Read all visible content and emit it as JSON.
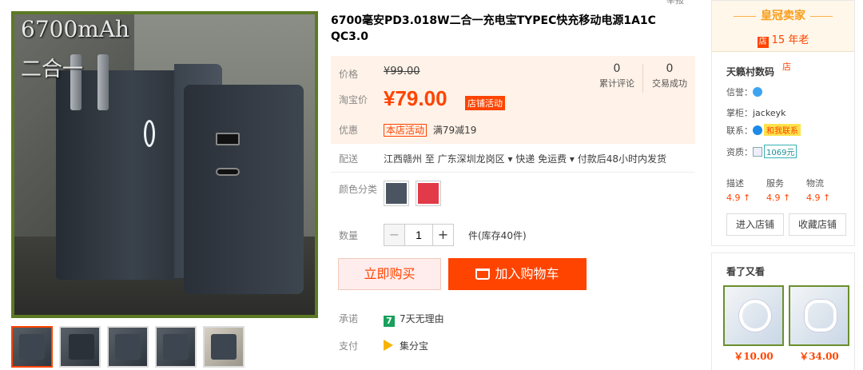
{
  "gallery": {
    "overlay_line1": "6700mAh",
    "overlay_line2": "二合一",
    "thumb_count": 5
  },
  "product": {
    "title": "6700毫安PD3.018W二合一充电宝TYPEC快充移动电源1A1C QC3.0",
    "topright": "举报"
  },
  "price": {
    "label": "价格",
    "original": "¥99.00",
    "tb_label": "淘宝价",
    "current": "¥79.00",
    "promo_tag": "店铺活动"
  },
  "stats": [
    {
      "num": "0",
      "label": "累计评论"
    },
    {
      "num": "0",
      "label": "交易成功"
    }
  ],
  "promotion": {
    "label": "优惠",
    "tag": "本店活动",
    "text": "满79减19"
  },
  "delivery": {
    "label": "配送",
    "text": "江西赣州 至  广东深圳龙岗区 ▾   快递 免运费 ▾   付款后48小时内发货"
  },
  "color": {
    "label": "颜色分类",
    "swatches": [
      "#4a5561",
      "#e23a48"
    ]
  },
  "quantity": {
    "label": "数量",
    "value": "1",
    "minus": "−",
    "plus": "+",
    "stock": "件(库存40件)"
  },
  "actions": {
    "buy_now": "立即购买",
    "add_cart": "加入购物车"
  },
  "assurance": {
    "label": "承诺",
    "icon_text": "7",
    "text": "7天无理由"
  },
  "payment": {
    "label": "支付",
    "text": "集分宝"
  },
  "shop": {
    "crown_title": "皇冠卖家",
    "years_badge": "店",
    "years": "15 年老",
    "name": "天籁村数码",
    "name_badge": "店",
    "credit_key": "信誉：",
    "keeper_key": "掌柜：",
    "keeper": "jackeyk",
    "contact_key": "联系：",
    "contact_badge": "和我联系",
    "qualification_key": "资质：",
    "deposit": "1069元",
    "scores": [
      {
        "label": "描述",
        "value": "4.9 ↑"
      },
      {
        "label": "服务",
        "value": "4.9 ↑"
      },
      {
        "label": "物流",
        "value": "4.9 ↑"
      }
    ],
    "enter_store": "进入店铺",
    "favorite_store": "收藏店铺"
  },
  "also_viewed": {
    "title": "看了又看",
    "items": [
      {
        "price": "￥10.00"
      },
      {
        "price": "￥34.00"
      }
    ]
  }
}
